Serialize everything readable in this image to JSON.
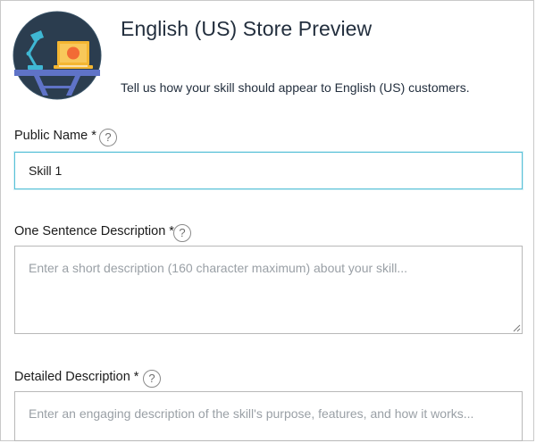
{
  "header": {
    "title": "English (US) Store Preview",
    "subtitle": "Tell us how your skill should appear to English (US) customers.",
    "logo_icon": "desk-lamp-laptop-icon"
  },
  "fields": [
    {
      "label": "Public Name *",
      "help": "?",
      "value": "Skill 1",
      "placeholder": ""
    },
    {
      "label": "One Sentence Description *",
      "help": "?",
      "value": "",
      "placeholder": "Enter a short description (160 character maximum) about your skill..."
    },
    {
      "label": "Detailed Description *",
      "help": "?",
      "value": "",
      "placeholder": "Enter an engaging description of the skill's purpose, features, and how it works..."
    }
  ],
  "colors": {
    "logo_background": "#2b3d4f",
    "logo_accent": "#3fb7d3",
    "logo_laptop": "#f4b632",
    "logo_sun": "#f26b35",
    "desk": "#5f73c7",
    "input_focus_border": "#59c1d8"
  }
}
